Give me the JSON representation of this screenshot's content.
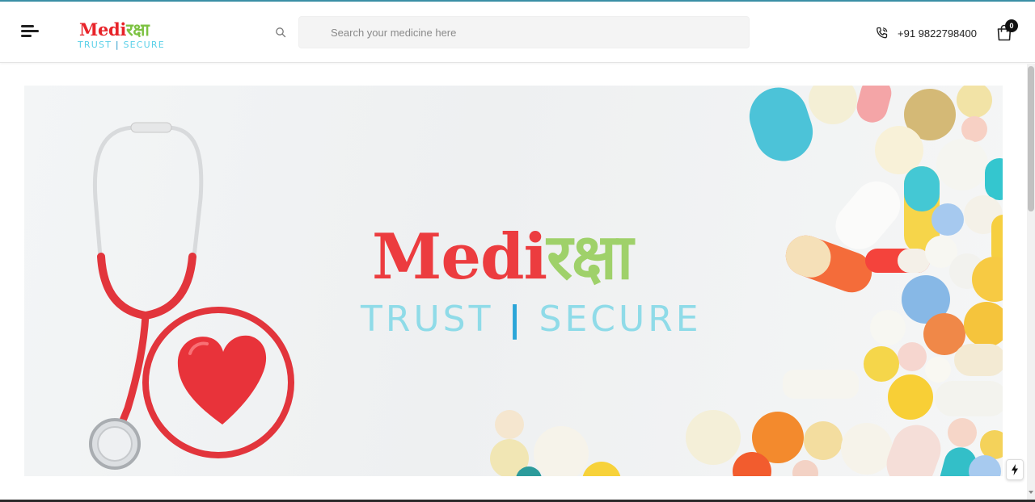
{
  "header": {
    "logo": {
      "main_red": "Medi",
      "main_green": "रक्षा",
      "tag_left": "TRUST",
      "tag_sep": "|",
      "tag_right": "SECURE"
    },
    "search": {
      "placeholder": "Search your medicine here"
    },
    "phone": "+91 9822798400",
    "cart": {
      "count": "0"
    }
  },
  "banner": {
    "logo": {
      "main_red": "Medi",
      "main_green": "रक्षा",
      "tag_left": "TRUST",
      "tag_sep": "|",
      "tag_right": "SECURE"
    }
  },
  "icons": [
    "menu-icon",
    "search-icon",
    "phone-icon",
    "cart-icon",
    "stethoscope-icon",
    "heart-icon",
    "lightning-icon"
  ],
  "colors": {
    "brand_red": "#e8242a",
    "brand_green": "#7dc242",
    "brand_cyan": "#5ad0e8",
    "accent_blue": "#2196c8",
    "header_accent": "#3a8fa6"
  }
}
